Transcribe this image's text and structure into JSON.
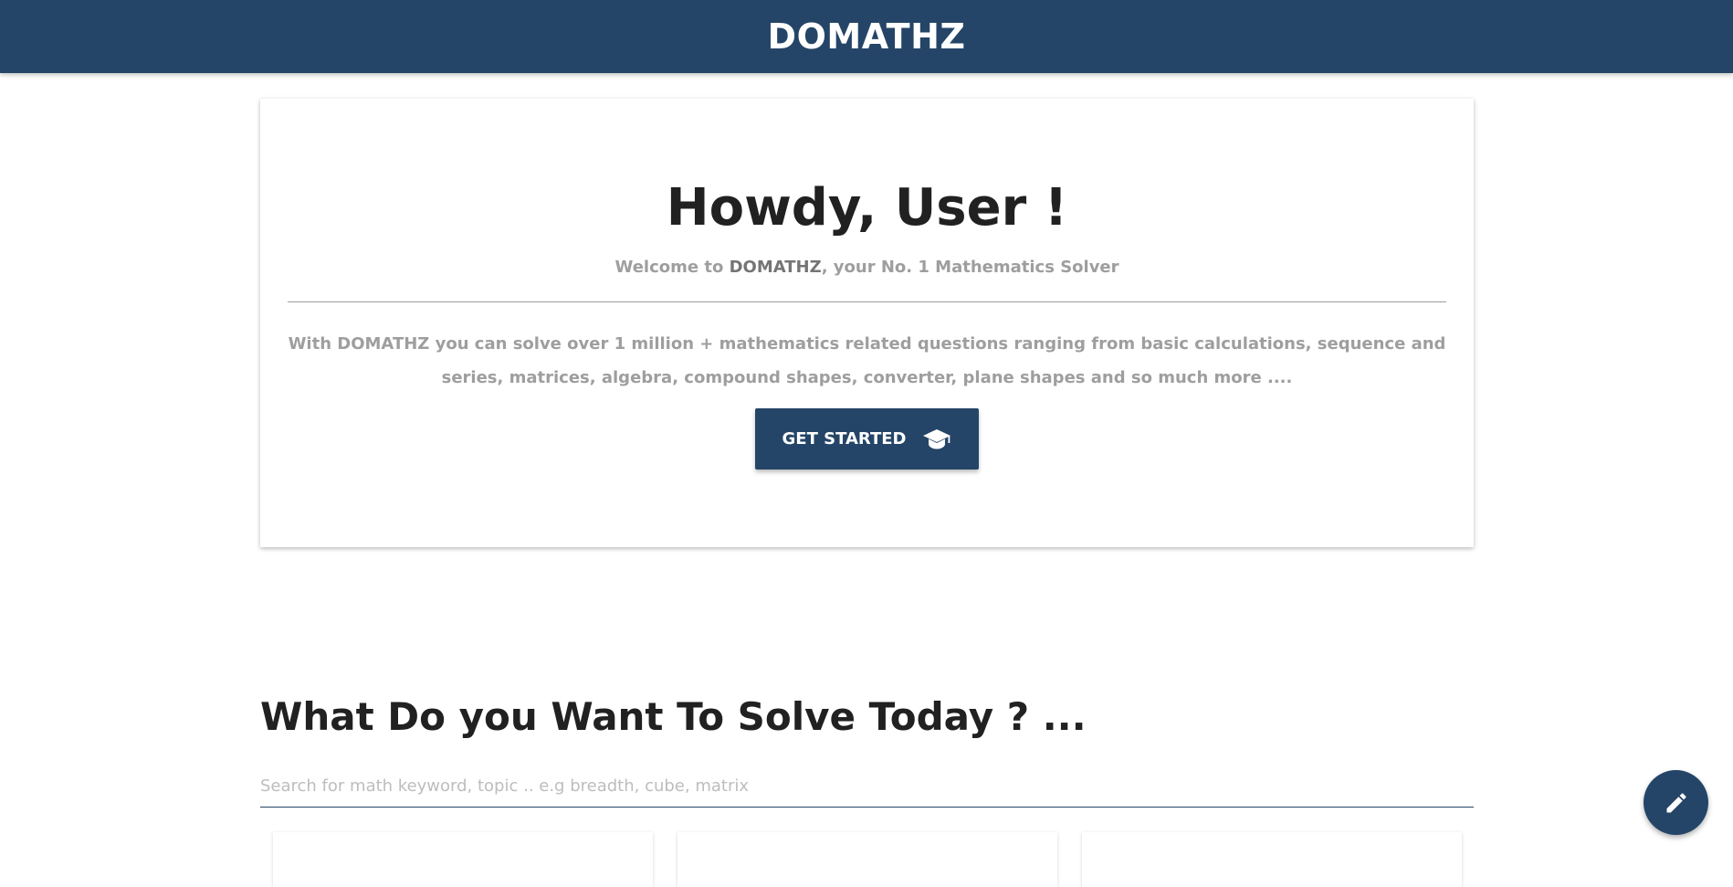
{
  "header": {
    "brand": "DOMATHZ"
  },
  "hero": {
    "title": "Howdy, User !",
    "subtitle_prefix": "Welcome to ",
    "subtitle_brand": "DOMATHZ",
    "subtitle_suffix": ", your No. 1 Mathematics Solver",
    "description": "With DOMATHZ you can solve over 1 million + mathematics related questions ranging from basic calculations, sequence and series, matrices, algebra, compound shapes, converter, plane shapes and so much more ....",
    "cta_label": "GET STARTED",
    "cta_icon": "graduation-cap-icon"
  },
  "solve": {
    "title": "What Do you Want To Solve Today ? ...",
    "search_placeholder": "Search for math keyword, topic .. e.g breadth, cube, matrix",
    "search_value": ""
  },
  "fab": {
    "icon": "pencil-icon"
  },
  "colors": {
    "primary": "#244567",
    "text_dark": "#212121",
    "text_muted": "#9e9e9e"
  }
}
